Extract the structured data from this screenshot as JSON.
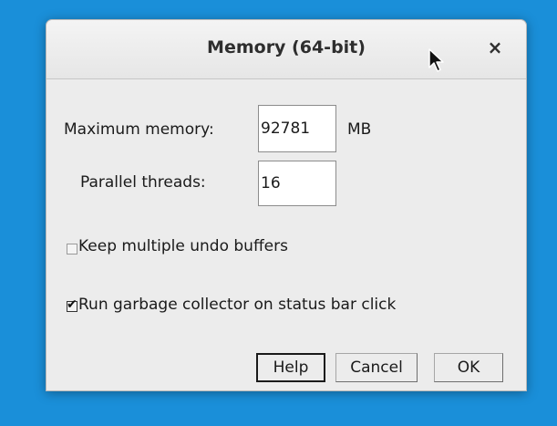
{
  "dialog": {
    "title": "Memory (64-bit)",
    "close_label": "×"
  },
  "form": {
    "max_memory_label": "Maximum memory:",
    "max_memory_value": "92781",
    "max_memory_unit": "MB",
    "threads_label": "Parallel threads:",
    "threads_value": "16"
  },
  "options": {
    "undo_label": "Keep multiple undo buffers",
    "undo_checked": false,
    "gc_label": "Run garbage collector on status bar click",
    "gc_checked": true
  },
  "buttons": {
    "help": "Help",
    "cancel": "Cancel",
    "ok": "OK"
  },
  "colors": {
    "desktop": "#1a8fd9",
    "dialog_bg": "#ececec"
  },
  "icons": {
    "close": "close-icon",
    "cursor": "mouse-pointer-icon"
  }
}
